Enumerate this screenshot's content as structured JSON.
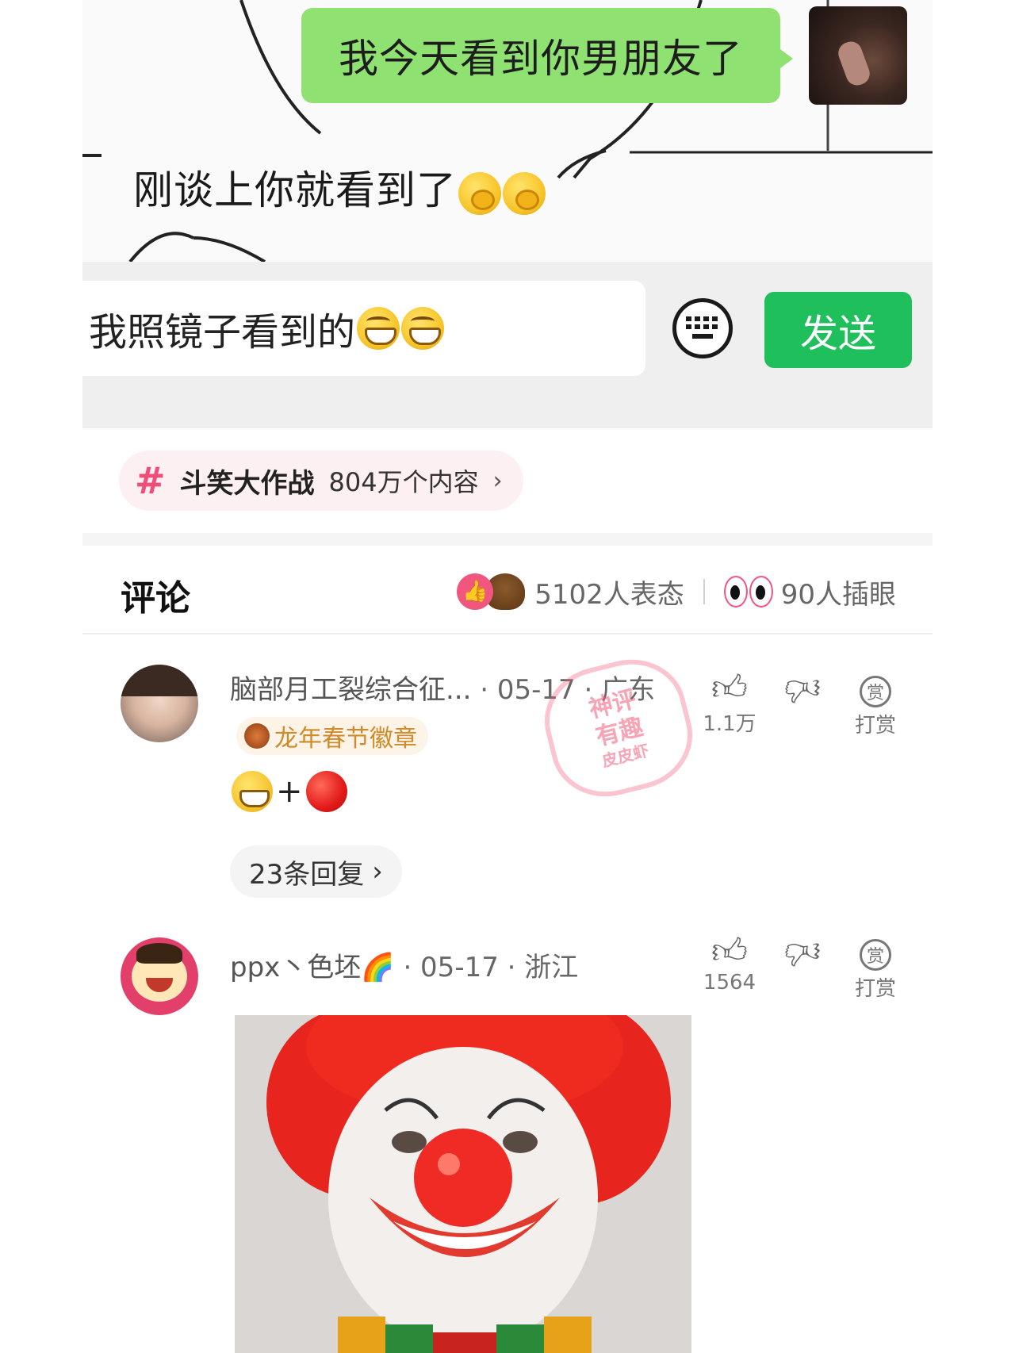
{
  "meme": {
    "bubble_text": "我今天看到你男朋友了",
    "reply_text": "刚谈上你就看到了",
    "input_text": "我照镜子看到的",
    "send_label": "发送"
  },
  "topic": {
    "name": "斗笑大作战",
    "count": "804万个内容",
    "chevron": "›"
  },
  "comments_header": {
    "title": "评论",
    "reactions_count": "5102人表态",
    "eyes_count": "90人插眼"
  },
  "comments": [
    {
      "username": "脑部月工裂综合征...",
      "date": "· 05-17",
      "location": "· 广东",
      "badge": "龙年春节徽章",
      "content_plus": "+",
      "likes": "1.1万",
      "reward_label": "打赏",
      "reward_icon_char": "赏",
      "replies": "23条回复",
      "replies_chevron": "›"
    },
    {
      "username": "ppx丶色坯🌈",
      "date": "· 05-17",
      "location": "· 浙江",
      "likes": "1564",
      "reward_label": "打赏",
      "reward_icon_char": "赏"
    }
  ],
  "watermark": {
    "line1": "神评",
    "line2": "有趣",
    "line3": "皮皮虾"
  },
  "colors": {
    "bubble_green": "#8fe272",
    "send_green": "#1fbf5c",
    "topic_pink": "#f04e79",
    "like_pink": "#f0567e"
  }
}
